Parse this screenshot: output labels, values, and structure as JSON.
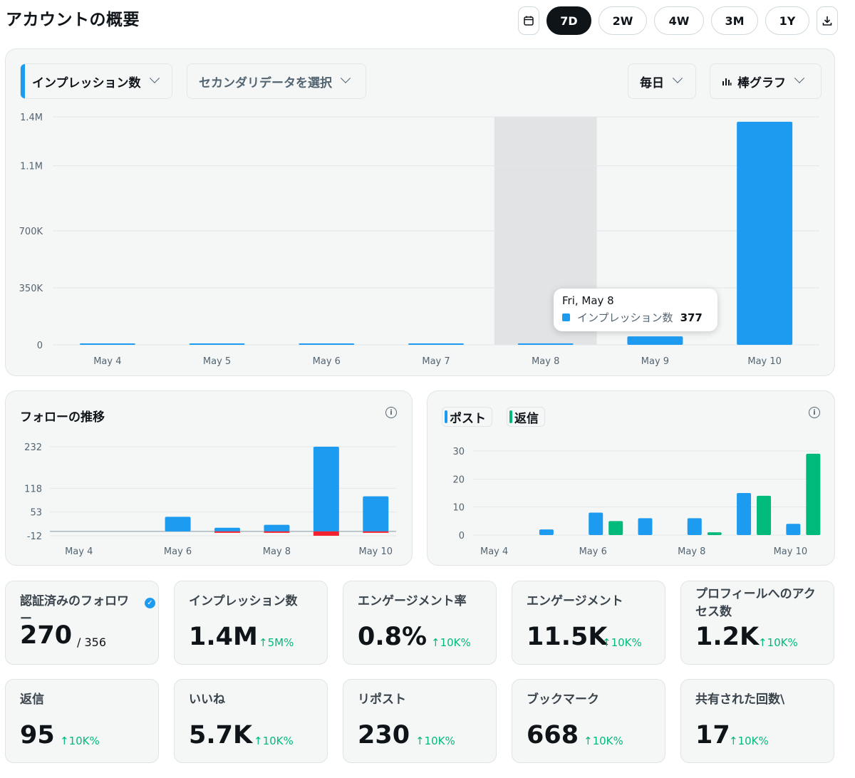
{
  "header": {
    "title": "アカウントの概要",
    "ranges": [
      "7D",
      "2W",
      "4W",
      "3M",
      "1Y"
    ],
    "active_range": "7D"
  },
  "main_chart_controls": {
    "primary_metric": "インプレッション数",
    "secondary_metric": "セカンダリデータを選択",
    "interval": "毎日",
    "chart_type": "棒グラフ"
  },
  "tooltip": {
    "date": "Fri, May 8",
    "series": "インプレッション数",
    "value": "377"
  },
  "follow_chart": {
    "title": "フォローの推移"
  },
  "posts_chart": {
    "legend_posts": "ポスト",
    "legend_replies": "返信"
  },
  "chart_data": [
    {
      "type": "bar",
      "categories": [
        "May 4",
        "May 5",
        "May 6",
        "May 7",
        "May 8",
        "May 9",
        "May 10"
      ],
      "series": [
        {
          "name": "インプレッション数",
          "values": [
            1200,
            900,
            1000,
            800,
            377,
            52000,
            1370000
          ],
          "color": "#1d9bf0"
        }
      ],
      "y_ticks": [
        "0",
        "350K",
        "700K",
        "1.1M",
        "1.4M"
      ],
      "ylim": [
        0,
        1400000
      ],
      "grid": true,
      "highlight_category": "May 8"
    },
    {
      "type": "bar",
      "categories": [
        "May 4",
        "May 5",
        "May 6",
        "May 7",
        "May 8",
        "May 9",
        "May 10"
      ],
      "x_tick_labels": [
        "May 4",
        "",
        "May 6",
        "",
        "May 8",
        "",
        "May 10"
      ],
      "series": [
        {
          "values": [
            0,
            0,
            40,
            10,
            18,
            232,
            96
          ],
          "color": "#1d9bf0"
        },
        {
          "values": [
            0,
            0,
            0,
            -1,
            -3,
            -12,
            -3
          ],
          "color": "#f4212e"
        }
      ],
      "y_ticks": [
        "-12",
        "53",
        "118",
        "232"
      ],
      "ylim": [
        -12,
        232
      ],
      "grid": true
    },
    {
      "type": "bar",
      "categories": [
        "May 4",
        "May 5",
        "May 6",
        "May 7",
        "May 8",
        "May 9",
        "May 10"
      ],
      "x_tick_labels": [
        "May 4",
        "",
        "May 6",
        "",
        "May 8",
        "",
        "May 10"
      ],
      "series": [
        {
          "name": "ポスト",
          "values": [
            0,
            2,
            8,
            6,
            6,
            15,
            4
          ],
          "color": "#1d9bf0"
        },
        {
          "name": "返信",
          "values": [
            0,
            0,
            5,
            0,
            1,
            14,
            29
          ],
          "color": "#00ba7c"
        }
      ],
      "y_ticks": [
        "0",
        "10",
        "20",
        "30"
      ],
      "ylim": [
        0,
        30
      ],
      "grid": true
    }
  ],
  "stats": [
    {
      "label": "認証済みのフォロワー",
      "value": "270",
      "sub": "/ 356",
      "verified": true
    },
    {
      "label": "インプレッション数",
      "value": "1.4M",
      "change": "5M%"
    },
    {
      "label": "エンゲージメント率",
      "value": "0.8%",
      "change": "10K%"
    },
    {
      "label": "エンゲージメント",
      "value": "11.5K",
      "change": "10K%"
    },
    {
      "label": "プロフィールへのアクセス数",
      "value": "1.2K",
      "change": "10K%"
    },
    {
      "label": "返信",
      "value": "95",
      "change": "10K%"
    },
    {
      "label": "いいね",
      "value": "5.7K",
      "change": "10K%"
    },
    {
      "label": "リポスト",
      "value": "230",
      "change": "10K%"
    },
    {
      "label": "ブックマーク",
      "value": "668",
      "change": "10K%"
    },
    {
      "label": "共有された回数\\",
      "value": "17",
      "change": "10K%"
    }
  ],
  "icons": {
    "calendar": "calendar-icon",
    "download": "download-icon",
    "info": "info-icon",
    "bar_chart": "bar-chart-icon",
    "up_arrow": "arrow-up-icon"
  },
  "colors": {
    "accent": "#1d9bf0",
    "positive": "#00ba7c",
    "negative": "#f4212e",
    "text": "#0f1419"
  }
}
